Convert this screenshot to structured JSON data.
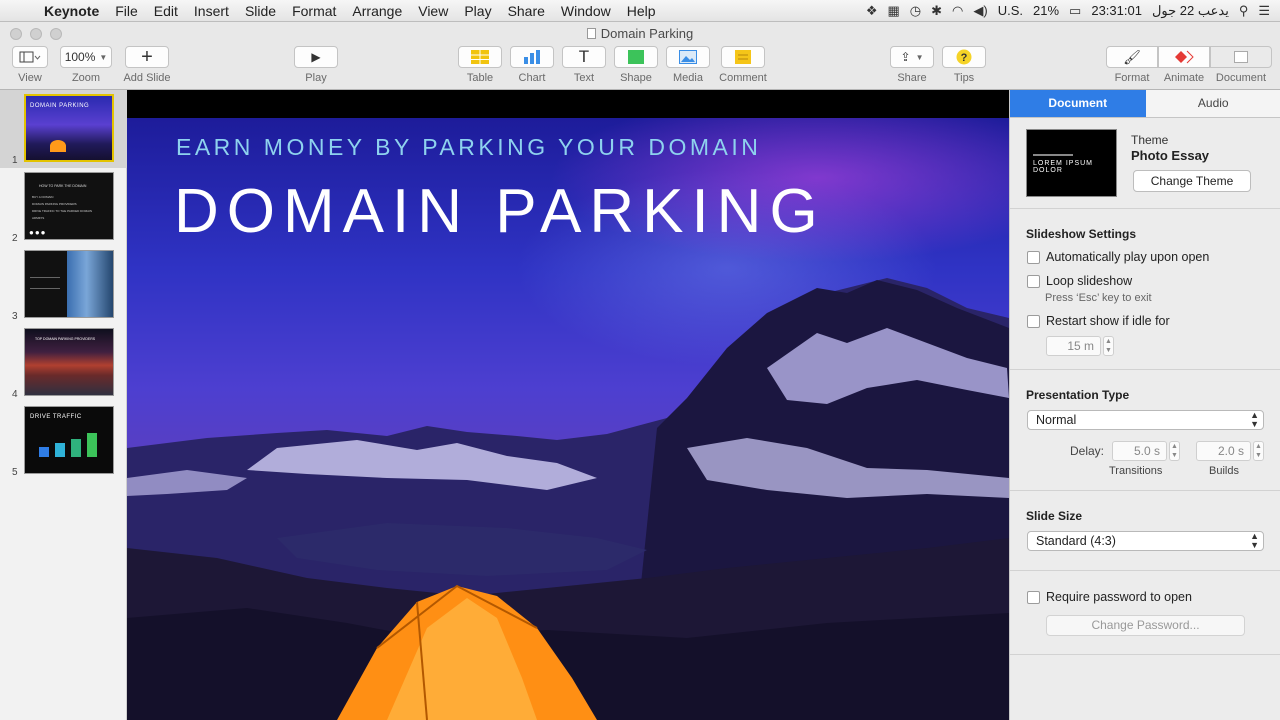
{
  "menubar": {
    "app": "Keynote",
    "items": [
      "File",
      "Edit",
      "Insert",
      "Slide",
      "Format",
      "Arrange",
      "View",
      "Play",
      "Share",
      "Window",
      "Help"
    ],
    "status": {
      "input_source": "U.S.",
      "battery": "21%",
      "clock": "23:31:01",
      "date": "يدعب 22 جول"
    }
  },
  "window": {
    "title": "Domain Parking"
  },
  "toolbar": {
    "view": "View",
    "zoom": "Zoom",
    "zoom_value": "100%",
    "add_slide": "Add Slide",
    "play": "Play",
    "table": "Table",
    "chart": "Chart",
    "text": "Text",
    "shape": "Shape",
    "media": "Media",
    "comment": "Comment",
    "share": "Share",
    "tips": "Tips",
    "format": "Format",
    "animate": "Animate",
    "document": "Document"
  },
  "navigator": {
    "slides": [
      {
        "num": "1",
        "title": "DOMAIN PARKING"
      },
      {
        "num": "2",
        "title": "HOW TO PARK THE DOMAIN",
        "lines": [
          "BUY A DOMAIN",
          "DOMAIN PARKING PROVIDERS",
          "DRIVE TRAFFIC TO THE PARKED DOMAIN",
          "ADMIN'S"
        ]
      },
      {
        "num": "3"
      },
      {
        "num": "4",
        "title": "TOP DOMAIN PARKING PROVIDERS"
      },
      {
        "num": "5",
        "title": "DRIVE TRAFFIC"
      }
    ]
  },
  "slide": {
    "subtitle": "EARN MONEY BY PARKING YOUR DOMAIN",
    "title": "DOMAIN PARKING"
  },
  "inspector": {
    "tabs": [
      "Document",
      "Audio"
    ],
    "theme_label": "Theme",
    "theme_name": "Photo Essay",
    "theme_thumb_text": "LOREM IPSUM DOLOR",
    "change_theme": "Change Theme",
    "slideshow_settings": "Slideshow Settings",
    "auto_play": "Automatically play upon open",
    "loop": "Loop slideshow",
    "loop_hint": "Press ‘Esc’ key to exit",
    "restart_idle": "Restart show if idle for",
    "idle_value": "15 m",
    "presentation_type": "Presentation Type",
    "presentation_value": "Normal",
    "delay": "Delay:",
    "transitions_value": "5.0 s",
    "builds_value": "2.0 s",
    "transitions": "Transitions",
    "builds": "Builds",
    "slide_size": "Slide Size",
    "slide_size_value": "Standard (4:3)",
    "require_password": "Require password to open",
    "change_password": "Change Password..."
  },
  "colors": {
    "accent": "#2f7de6",
    "subtitle": "#8ed2ee",
    "selection": "#e3c300"
  }
}
